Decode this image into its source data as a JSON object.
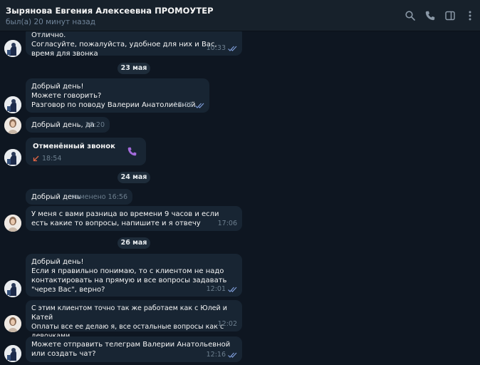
{
  "header": {
    "title": "Зырянова Евгения Алексеевна ПРОМОУТЕР",
    "status": "был(а) 20 минут назад",
    "icons": [
      "search-icon",
      "phone-icon",
      "sidebar-icon",
      "more-icon"
    ]
  },
  "dates": {
    "d1": "23 мая",
    "d2": "24 мая",
    "d3": "26 мая"
  },
  "messages": {
    "m0": {
      "text": "Отлично.\nСогласуйте, пожалуйста, удобное для них и Вас, время для звонка",
      "time": "10:33"
    },
    "m1": {
      "text": "Добрый день!\nМожете говорить?\nРазговор по поводу Валерии Анатолиевной",
      "time": "17:08"
    },
    "m2": {
      "text": "Добрый день, да",
      "time": "18:20"
    },
    "m3": {
      "title": "Отменённый звонок",
      "time": "18:54"
    },
    "m4": {
      "text": "Добрый день",
      "time": "изменено 16:56"
    },
    "m5": {
      "text": "У меня с вами разница во времени 9 часов и если есть какие то вопросы, напишите и я отвечу",
      "time": "17:06"
    },
    "m6": {
      "text": "Добрый день!\nЕсли я правильно понимаю, то с клиентом не надо контактировать на прямую и все вопросы задавать \"через Вас\", верно?",
      "time": "12:01"
    },
    "m7": {
      "text": "С этим клиентом точно так же работаем как с Юлей и Катей\nОплаты все ее делаю я, все остальные вопросы как с девочками",
      "time": "12:02"
    },
    "m8": {
      "text": "Можете отправить телеграм Валерии Анатольевной или создать чат?",
      "time": "12:16"
    }
  },
  "colors": {
    "background": "#0e1621",
    "bubble": "#182533",
    "header": "#17212b",
    "accent_check": "#7e9cd8",
    "call_icon": "#a36bdb",
    "missed_arrow": "#e06545"
  }
}
